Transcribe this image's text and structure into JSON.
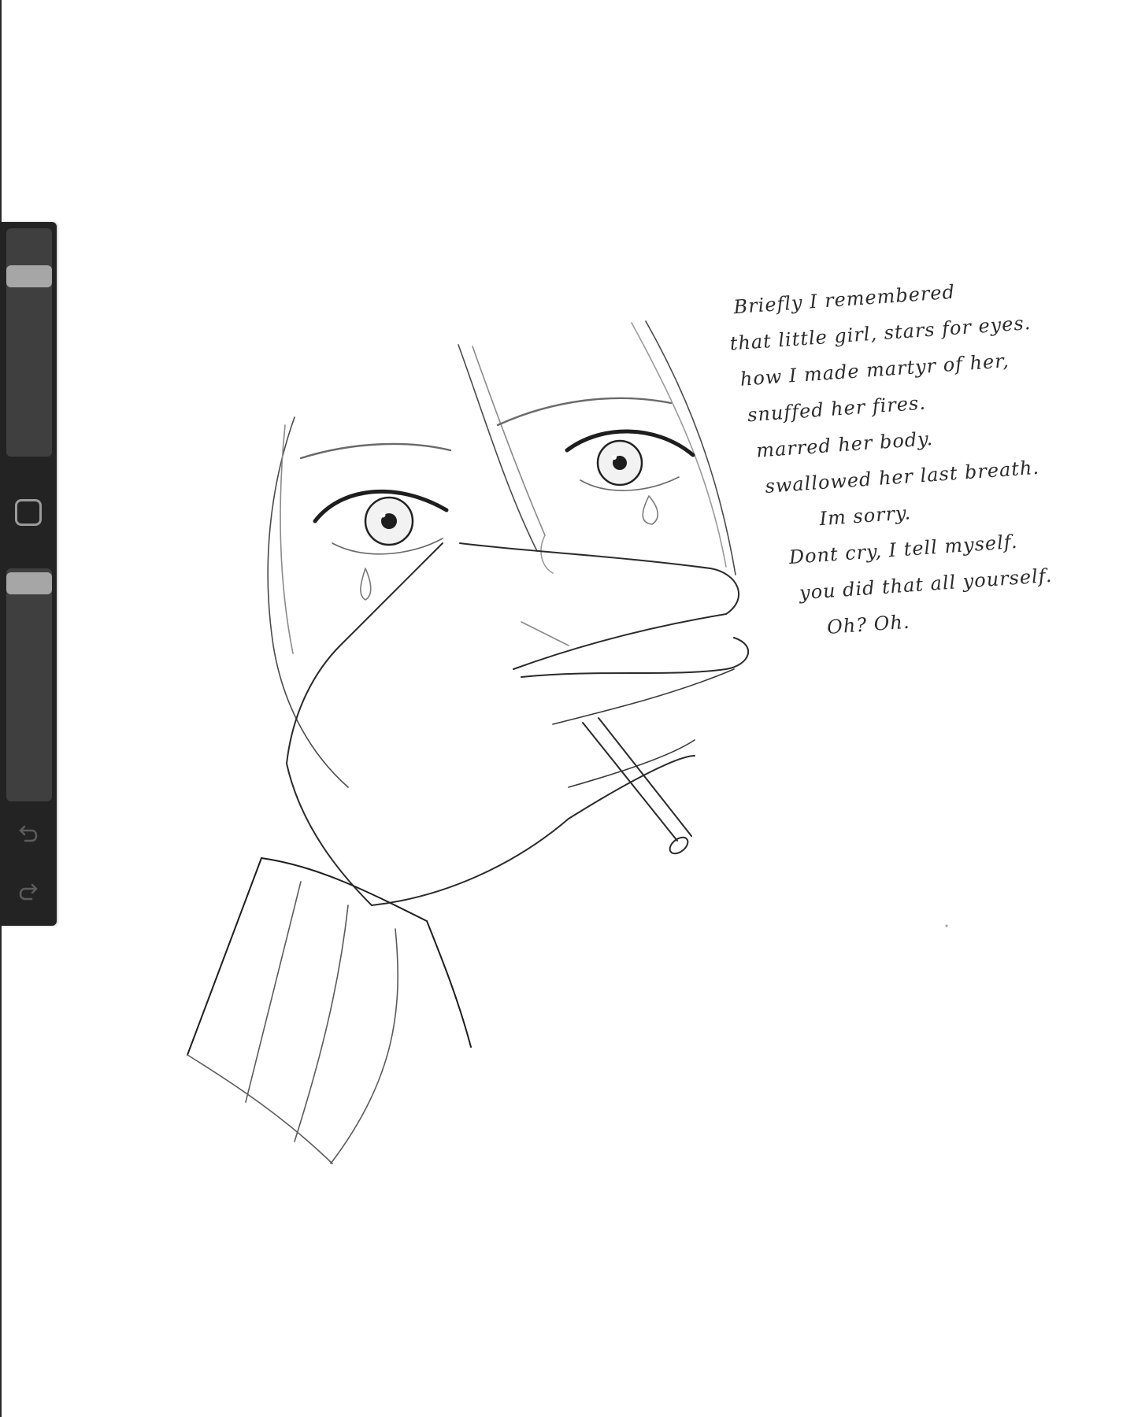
{
  "app": {
    "name": "drawing-canvas",
    "accent": "#a6a6a6",
    "sidebar_bg": "#232323",
    "slider_track": "#3f3f3f"
  },
  "sidebar": {
    "brush_size": {
      "level": 0.82,
      "icon": "brush-size-slider"
    },
    "modify": {
      "icon": "square-icon"
    },
    "opacity": {
      "level": 0.98,
      "icon": "brush-opacity-slider"
    },
    "undo": {
      "icon": "undo-arrow-icon"
    },
    "redo": {
      "icon": "redo-arrow-icon"
    }
  },
  "artwork": {
    "subject": "pencil sketch of a girl with a hand over her mouth holding a cigarette",
    "poem": [
      "Briefly I remembered",
      "that little girl, stars for eyes.",
      "how I made martyr of her,",
      "snuffed her fires.",
      "marred her body.",
      "swallowed her last breath.",
      "Im sorry.",
      "Dont cry, I tell myself.",
      "you did that all yourself.",
      "Oh? Oh."
    ]
  }
}
